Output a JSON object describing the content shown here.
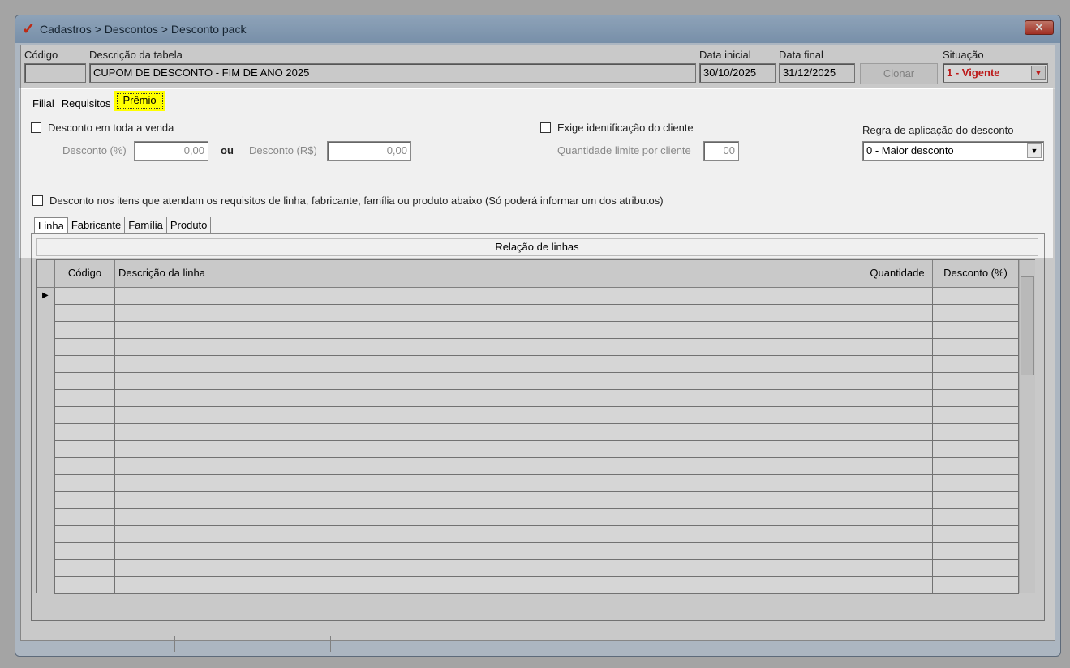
{
  "window": {
    "title": "Cadastros > Descontos > Desconto pack",
    "close": "✕",
    "logo": "✓"
  },
  "header": {
    "codigo_label": "Código",
    "codigo_value": "",
    "descricao_label": "Descrição da tabela",
    "descricao_value": "CUPOM DE DESCONTO - FIM DE ANO 2025",
    "data_inicial_label": "Data inicial",
    "data_inicial_value": "30/10/2025",
    "data_final_label": "Data final",
    "data_final_value": "31/12/2025",
    "clonar": "Clonar",
    "situacao_label": "Situação",
    "situacao_value": "1 - Vigente",
    "situacao_color": "#e02020"
  },
  "tabs": [
    "Filial",
    "Requisitos",
    "Prêmio"
  ],
  "premio": {
    "desconto_toda_venda": "Desconto em toda a venda",
    "desconto_pct_label": "Desconto (%)",
    "desconto_pct_value": "0,00",
    "ou": "ou",
    "desconto_rs_label": "Desconto (R$)",
    "desconto_rs_value": "0,00",
    "exige_id": "Exige identificação do cliente",
    "qtd_limite_label": "Quantidade limite por cliente",
    "qtd_limite_value": "00",
    "regra_label": "Regra de aplicação do desconto",
    "regra_value": "0 - Maior desconto",
    "desconto_itens": "Desconto nos itens que atendam os requisitos de linha, fabricante, família ou produto abaixo (Só poderá informar um dos atributos)"
  },
  "subtabs": [
    "Linha",
    "Fabricante",
    "Família",
    "Produto"
  ],
  "grid": {
    "title": "Relação de linhas",
    "columns": [
      "Código",
      "Descrição da linha",
      "Quantidade",
      "Desconto (%)"
    ],
    "row_count": 18
  },
  "highlight_color": "#ffff00"
}
